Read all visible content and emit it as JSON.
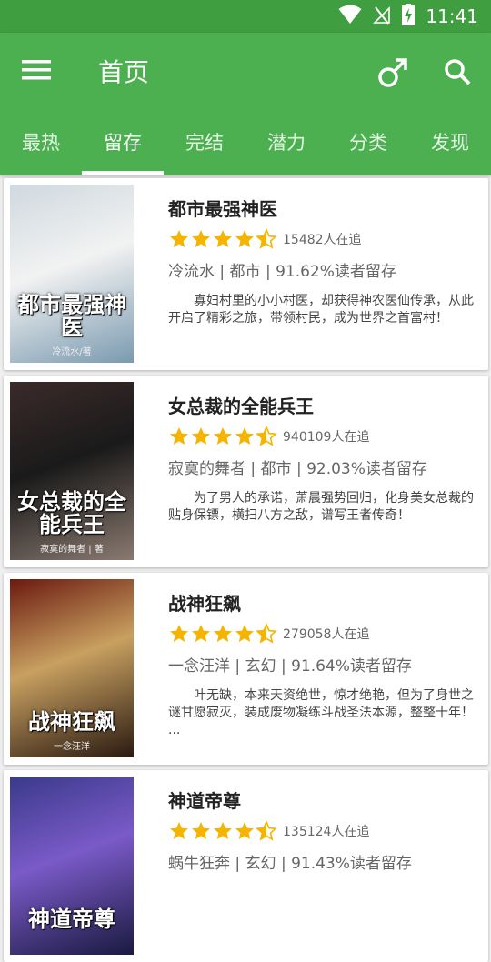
{
  "status": {
    "time": "11:41"
  },
  "toolbar": {
    "title": "首页"
  },
  "tabs": [
    "最热",
    "留存",
    "完结",
    "潜力",
    "分类",
    "发现"
  ],
  "active_tab": 1,
  "books": [
    {
      "title": "都市最强神医",
      "rating": 4.5,
      "followers": "15482人在追",
      "meta": "冷流水 | 都市 | 91.62%读者留存",
      "desc": "寡妇村里的小小村医，却获得神农医仙传承，从此开启了精彩之旅，带领村民，成为世界之首富村！",
      "cover_text": "都市最强神医",
      "cover_author": "冷流水/著",
      "cover_colors": [
        "#cfd9df",
        "#f2f2f2",
        "#7a9ab0"
      ]
    },
    {
      "title": "女总裁的全能兵王",
      "rating": 4.5,
      "followers": "940109人在追",
      "meta": "寂寞的舞者 | 都市 | 92.03%读者留存",
      "desc": "为了男人的承诺，萧晨强势回归，化身美女总裁的贴身保镖，横扫八方之敌，谱写王者传奇！",
      "cover_text": "女总裁的全能兵王",
      "cover_author": "寂寞的舞者 | 著",
      "cover_colors": [
        "#3b2a2a",
        "#1a1a1a",
        "#8a7a70"
      ]
    },
    {
      "title": "战神狂飙",
      "rating": 4.5,
      "followers": "279058人在追",
      "meta": "一念汪洋 | 玄幻 | 91.64%读者留存",
      "desc": "叶无缺，本来天资绝世，惊才绝艳，但为了身世之谜甘愿寂灭，装成废物凝练斗战圣法本源，整整十年！ ...",
      "cover_text": "战神狂飙",
      "cover_author": "一念汪洋",
      "cover_colors": [
        "#6b1a10",
        "#c8a060",
        "#2a1a12"
      ]
    },
    {
      "title": "神道帝尊",
      "rating": 4.5,
      "followers": "135124人在追",
      "meta": "蜗牛狂奔 | 玄幻 | 91.43%读者留存",
      "desc": "",
      "cover_text": "神道帝尊",
      "cover_author": "",
      "cover_colors": [
        "#3a3a8a",
        "#7a5ac8",
        "#1a1a40"
      ]
    }
  ]
}
